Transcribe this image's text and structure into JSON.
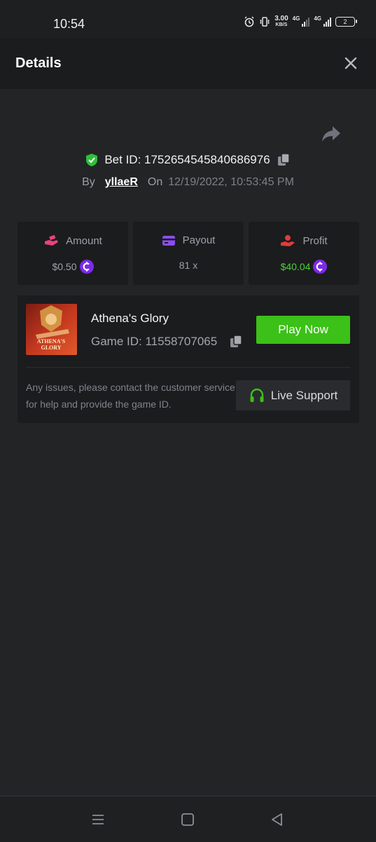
{
  "status_bar": {
    "time": "10:54",
    "speed_value": "3.00",
    "speed_unit": "KB/S",
    "network_a": "4G",
    "network_b": "4G",
    "battery": "2"
  },
  "header": {
    "title": "Details",
    "close_icon": "close-icon"
  },
  "bet": {
    "id_label": "Bet ID: 1752654545840686976",
    "by_label": "By",
    "username": "yllaeR",
    "on_label": "On",
    "datetime": "12/19/2022, 10:53:45 PM"
  },
  "stats": [
    {
      "label": "Amount",
      "value": "$0.50",
      "icon": "hand-money-icon",
      "icon_color": "#e8437d",
      "value_color": "#9ea1a8",
      "has_coin": true
    },
    {
      "label": "Payout",
      "value": "81 x",
      "icon": "card-icon",
      "icon_color": "#8a4df0",
      "value_color": "#9ea1a8",
      "has_coin": false
    },
    {
      "label": "Profit",
      "value": "$40.04",
      "icon": "profit-hand-icon",
      "icon_color": "#e33b3b",
      "value_color": "#4cd137",
      "has_coin": true
    }
  ],
  "game": {
    "name": "Athena's Glory",
    "id_label": "Game ID: 11558707065",
    "thumb_text_1": "ATHENA'S",
    "thumb_text_2": "GLORY",
    "play_label": "Play Now",
    "issue_text": "Any issues, please contact the customer service for help and provide the game ID.",
    "support_label": "Live Support"
  },
  "colors": {
    "background": "#232426",
    "card": "#1b1c1e",
    "accent_green": "#3bc117",
    "coin_purple": "#7c2ae8"
  }
}
